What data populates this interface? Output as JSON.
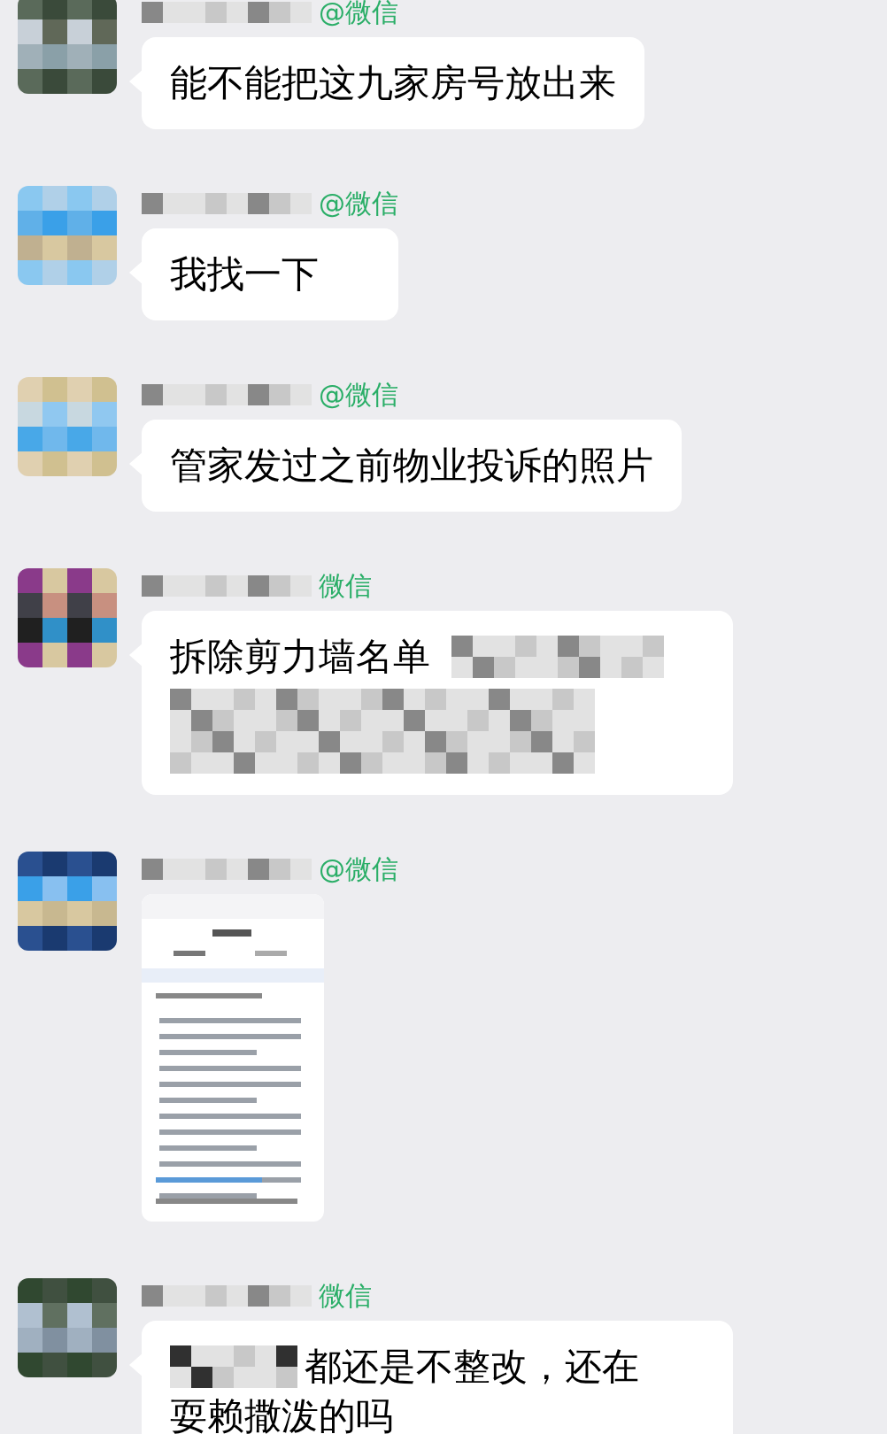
{
  "messages": [
    {
      "kind": "text",
      "sender_suffix": "@微信",
      "lines": [
        "能不能把这九家房号放出来"
      ]
    },
    {
      "kind": "text",
      "sender_suffix": "@微信",
      "lines": [
        "我找一下"
      ]
    },
    {
      "kind": "text",
      "sender_suffix": "@微信",
      "lines": [
        "管家发过之前物业投诉的照片"
      ]
    },
    {
      "kind": "masked_text",
      "sender_suffix": "微信",
      "lines": [
        "拆除剪力墙名单"
      ]
    },
    {
      "sender_suffix": "@微信"
    },
    {
      "kind": "masked_lead",
      "sender_suffix": "微信",
      "lines": [
        "都还是不整改，还在",
        "耍赖撒泼的吗"
      ]
    }
  ]
}
